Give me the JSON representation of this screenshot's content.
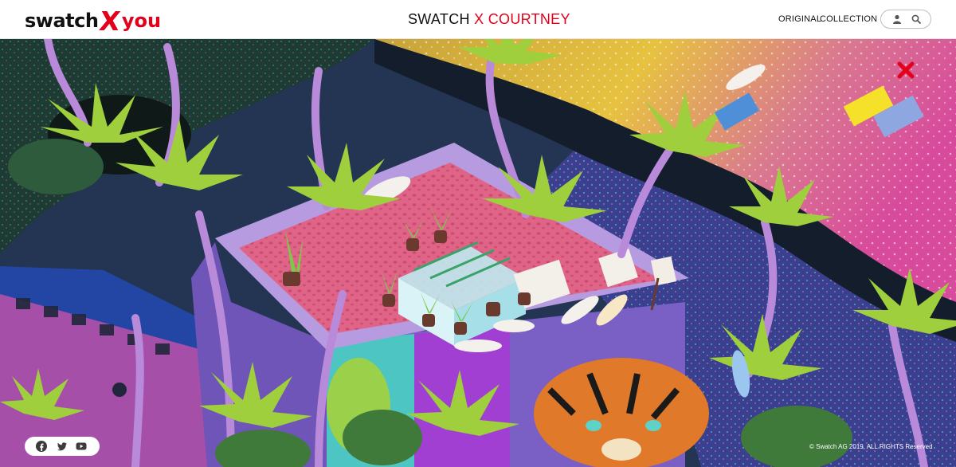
{
  "header": {
    "logo": {
      "part1": "swatch",
      "part2": "X",
      "part3": "you"
    },
    "title_part1": "SWATCH",
    "title_part2": "X COURTNEY",
    "nav": [
      "ORIGINAL",
      "COLLECTION"
    ],
    "icons": [
      "user-icon",
      "search-icon"
    ]
  },
  "hero": {
    "close_icon": "close-icon",
    "colors": {
      "accent": "#e3001b",
      "pink": "#d64a6e",
      "purple": "#8e6ad1",
      "sand": "#e9c23a",
      "jungle": "#1f3b2e"
    }
  },
  "footer": {
    "social": [
      "facebook-icon",
      "twitter-icon",
      "youtube-icon"
    ],
    "copyright": "© Swatch AG 2019, ALL RIGHTS Reserved"
  }
}
